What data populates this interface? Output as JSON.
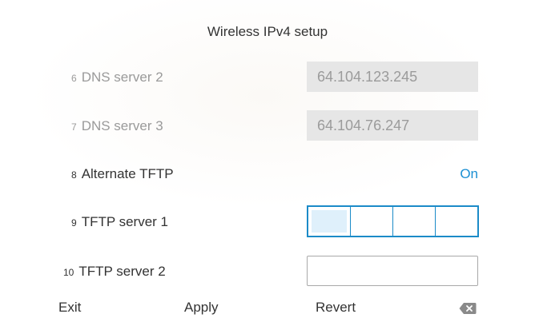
{
  "title": "Wireless IPv4 setup",
  "rows": [
    {
      "num": "6",
      "label": "DNS server 2",
      "value": "64.104.123.245",
      "state": "disabled"
    },
    {
      "num": "7",
      "label": "DNS server 3",
      "value": "64.104.76.247",
      "state": "disabled"
    },
    {
      "num": "8",
      "label": "Alternate TFTP",
      "value": "On",
      "state": "enabled"
    },
    {
      "num": "9",
      "label": "TFTP server 1",
      "value": "",
      "state": "editing"
    },
    {
      "num": "10",
      "label": "TFTP server 2",
      "value": "",
      "state": "enabled"
    }
  ],
  "softkeys": {
    "exit": "Exit",
    "apply": "Apply",
    "revert": "Revert",
    "backspace_icon": "backspace-icon"
  },
  "colors": {
    "accent": "#1a8fd3",
    "field_border_active": "#1b8bc8",
    "readonly_bg": "#e6e6e6",
    "disabled_text": "#9a9a9a"
  }
}
